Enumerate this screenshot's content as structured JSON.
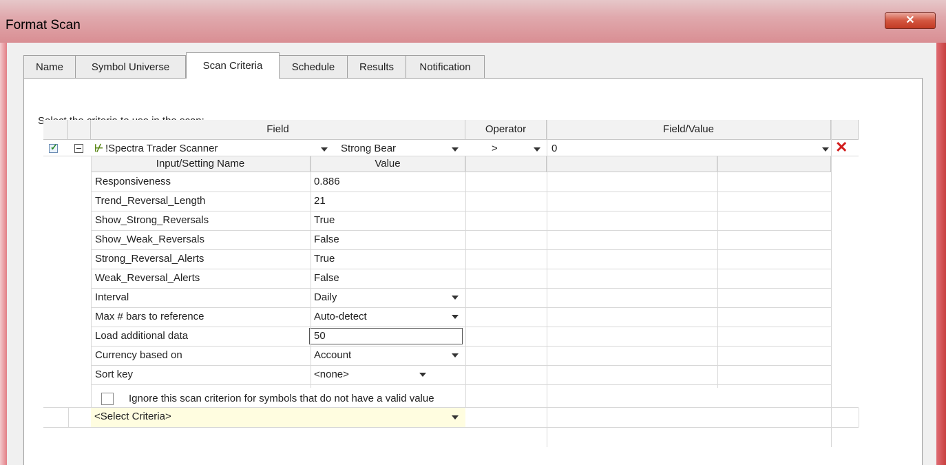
{
  "window": {
    "title": "Format Scan",
    "close_glyph": "✕"
  },
  "tabs": [
    {
      "label": "Name"
    },
    {
      "label": "Symbol Universe"
    },
    {
      "label": "Scan Criteria",
      "active": true
    },
    {
      "label": "Schedule"
    },
    {
      "label": "Results"
    },
    {
      "label": "Notification"
    }
  ],
  "instructions": "Select the criteria to use in the scan:",
  "grid": {
    "headers": {
      "field": "Field",
      "operator": "Operator",
      "field_value": "Field/Value"
    },
    "criterion": {
      "enabled": true,
      "indicator_icon": "indicator-icon",
      "field": "!Spectra Trader Scanner",
      "sub_field": "Strong Bear",
      "operator": ">",
      "value": "0"
    },
    "input_headers": {
      "name": "Input/Setting Name",
      "value": "Value"
    },
    "inputs": [
      {
        "name": "Responsiveness",
        "value": "0.886",
        "dropdown": false
      },
      {
        "name": "Trend_Reversal_Length",
        "value": "21",
        "dropdown": false
      },
      {
        "name": "Show_Strong_Reversals",
        "value": "True",
        "dropdown": false
      },
      {
        "name": "Show_Weak_Reversals",
        "value": "False",
        "dropdown": false
      },
      {
        "name": "Strong_Reversal_Alerts",
        "value": "True",
        "dropdown": false
      },
      {
        "name": "Weak_Reversal_Alerts",
        "value": "False",
        "dropdown": false
      },
      {
        "name": "Interval",
        "value": "Daily",
        "dropdown": true
      },
      {
        "name": "Max # bars to reference",
        "value": "Auto-detect",
        "dropdown": true
      },
      {
        "name": "Load additional data",
        "value": "50",
        "dropdown": false,
        "editing": true
      },
      {
        "name": "Currency based on",
        "value": "Account",
        "dropdown": true
      },
      {
        "name": "Sort key",
        "value": "<none>",
        "dropdown": true
      }
    ],
    "ignore_option": {
      "label": "Ignore this scan criterion for symbols that do not have a valid value",
      "checked": false
    },
    "select_criteria": "<Select Criteria>"
  }
}
